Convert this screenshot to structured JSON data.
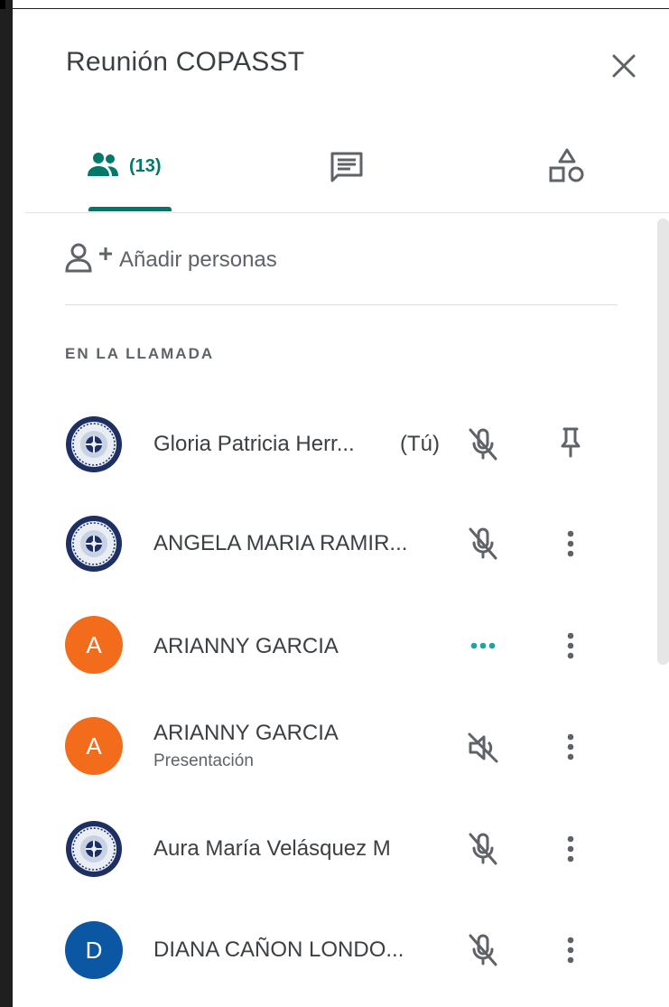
{
  "panel": {
    "title": "Reunión COPASST",
    "tabs": [
      {
        "label": "(13)",
        "icon": "people-icon"
      },
      {
        "icon": "chat-icon"
      },
      {
        "icon": "activities-icon"
      }
    ],
    "add_people_label": "Añadir personas",
    "section_title": "EN LA LLAMADA"
  },
  "participants": [
    {
      "name": "Gloria Patricia Herr...",
      "suffix": "(Tú)",
      "avatar": "emblem",
      "status": "mic-off-icon",
      "action": "pin-icon"
    },
    {
      "name": "ANGELA MARIA RAMIR...",
      "avatar": "emblem",
      "status": "mic-off-icon",
      "action": "more-vert-icon"
    },
    {
      "name": "ARIANNY GARCIA",
      "avatar_letter": "A",
      "avatar_color": "#f26c1c",
      "status": "speaking-dots-icon",
      "action": "more-vert-icon"
    },
    {
      "name": "ARIANNY GARCIA",
      "subtitle": "Presentación",
      "avatar_letter": "A",
      "avatar_color": "#f26c1c",
      "status": "volume-off-icon",
      "action": "more-vert-icon"
    },
    {
      "name": "Aura María Velásquez M",
      "avatar": "emblem",
      "status": "mic-off-icon",
      "action": "more-vert-icon"
    },
    {
      "name": "DIANA CAÑON LONDO...",
      "avatar_letter": "D",
      "avatar_color": "#0b57a4",
      "status": "mic-off-icon",
      "action": "more-vert-icon"
    }
  ],
  "colors": {
    "accent": "#00796b",
    "speaking": "#1aa5a0",
    "icon_grey": "#5f6368"
  }
}
